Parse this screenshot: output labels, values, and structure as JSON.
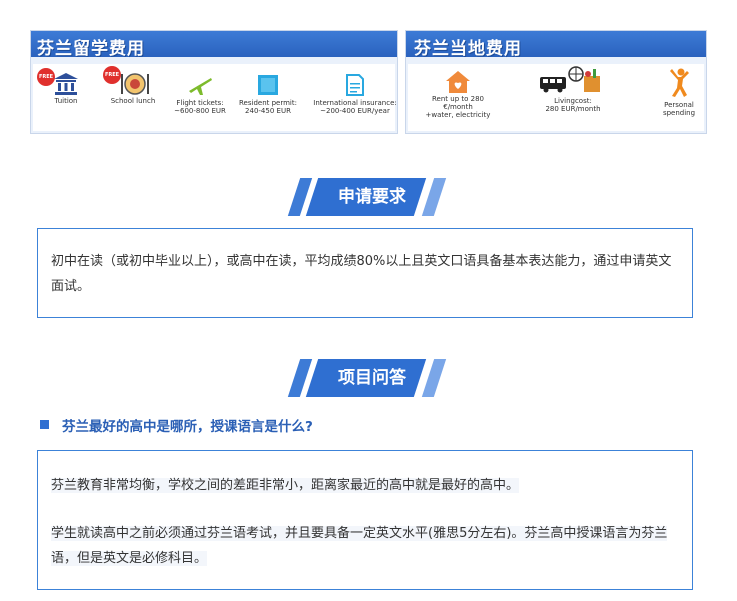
{
  "banner": {
    "left_title": "芬兰留学费用",
    "right_title": "芬兰当地费用",
    "free_badge": "FREE",
    "study_items": [
      {
        "label": "Tuition",
        "icon": "museum-icon"
      },
      {
        "label": "School lunch",
        "icon": "meal-plate-icon"
      },
      {
        "label": "Flight tickets:\n~600-800 EUR",
        "icon": "airplane-icon"
      },
      {
        "label": "Resident permit:\n240-450 EUR",
        "icon": "permit-card-icon"
      },
      {
        "label": "International insurance:\n~200-400 EUR/year",
        "icon": "document-icon"
      }
    ],
    "local_items": [
      {
        "label": "Rent up to 280\n€/month\n+water, electricity",
        "icon": "house-icon"
      },
      {
        "label": "Livingcost:\n280 EUR/month",
        "icon": "bus-globe-groceries-icon"
      },
      {
        "label": "Personal\nspending",
        "icon": "person-cheering-icon"
      }
    ]
  },
  "sections": {
    "requirements": {
      "title": "申请要求",
      "text": "初中在读（或初中毕业以上），或高中在读，平均成绩80%以上且英文口语具备基本表达能力，通过申请英文面试。"
    },
    "faq": {
      "title": "项目问答",
      "question": "芬兰最好的高中是哪所，授课语言是什么?",
      "answer_1": "芬兰教育非常均衡，学校之间的差距非常小，距离家最近的高中就是最好的高中。",
      "answer_2": "学生就读高中之前必须通过芬兰语考试，并且要具备一定英文水平(雅思5分左右)。芬兰高中授课语言为芬兰语，但是英文是必修科目。"
    }
  },
  "colors": {
    "accent": "#2f6fd1",
    "border": "#3c82d8",
    "question": "#2a5fb5"
  }
}
